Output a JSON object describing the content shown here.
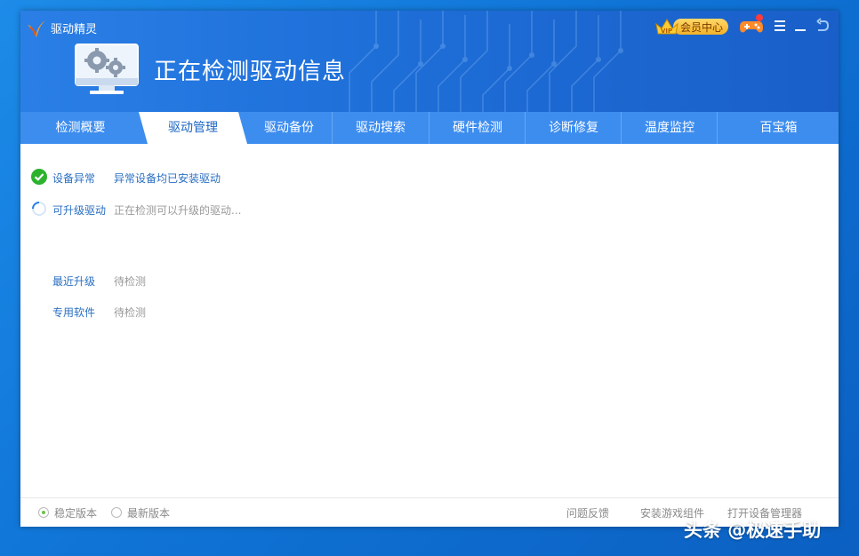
{
  "app": {
    "title": "驱动精灵"
  },
  "header": {
    "title": "正在检测驱动信息",
    "vip_label": "会员中心"
  },
  "tabs": [
    {
      "label": "检测概要",
      "active": false
    },
    {
      "label": "驱动管理",
      "active": true
    },
    {
      "label": "驱动备份",
      "active": false
    },
    {
      "label": "驱动搜索",
      "active": false
    },
    {
      "label": "硬件检测",
      "active": false
    },
    {
      "label": "诊断修复",
      "active": false
    },
    {
      "label": "温度监控",
      "active": false
    },
    {
      "label": "百宝箱",
      "active": false
    }
  ],
  "status": {
    "device_error": {
      "label": "设备异常",
      "value": "异常设备均已安装驱动"
    },
    "upgradable": {
      "label": "可升级驱动",
      "value": "正在检测可以升级的驱动..."
    },
    "recent_upgrade": {
      "label": "最近升级",
      "value": "待检测"
    },
    "dedicated_software": {
      "label": "专用软件",
      "value": "待检测"
    }
  },
  "footer": {
    "stable_version": "稳定版本",
    "latest_version": "最新版本",
    "selected": "stable",
    "feedback": "问题反馈",
    "install_game": "安装游戏组件",
    "open_device_manager": "打开设备管理器"
  },
  "watermark": "头条 @极速手助",
  "colors": {
    "header_blue": "#1e6ed8",
    "tab_blue": "#3d8def",
    "link_blue": "#2a6fc2",
    "success_green": "#2db22d"
  }
}
